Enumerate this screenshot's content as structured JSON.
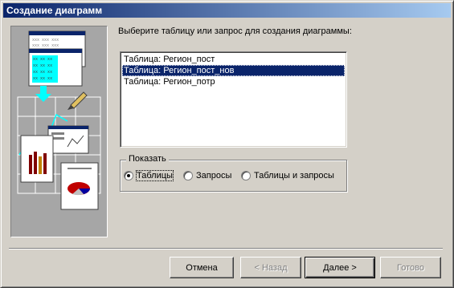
{
  "window": {
    "title": "Создание диаграмм"
  },
  "prompt": "Выберите таблицу или запрос для создания диаграммы:",
  "list": {
    "items": [
      "Таблица: Регион_пост",
      "Таблица: Регион_пост_нов",
      "Таблица: Регион_потр"
    ],
    "selected_index": 1
  },
  "show_group": {
    "label": "Показать",
    "options": [
      "Таблицы",
      "Запросы",
      "Таблицы и запросы"
    ],
    "selected_index": 0
  },
  "buttons": {
    "cancel": "Отмена",
    "back": "< Назад",
    "next": "Далее >",
    "finish": "Готово"
  },
  "colors": {
    "title_start": "#0a246a",
    "title_end": "#a6caf0",
    "selection": "#0a246a",
    "face": "#d4d0c8"
  }
}
